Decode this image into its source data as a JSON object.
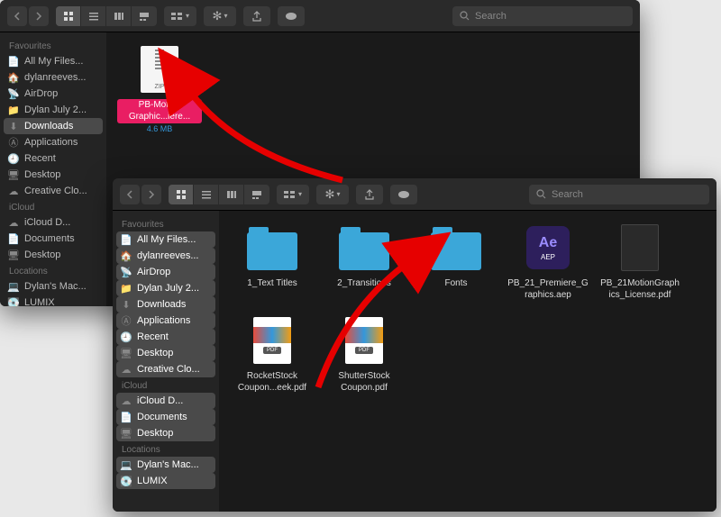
{
  "search_placeholder": "Search",
  "sidebar_common": {
    "favourites_header": "Favourites",
    "icloud_header": "iCloud",
    "locations_header": "Locations",
    "items_favourites": [
      {
        "icon": "doc",
        "label": "All My Files..."
      },
      {
        "icon": "house",
        "label": "dylanreeves..."
      },
      {
        "icon": "airdrop",
        "label": "AirDrop"
      },
      {
        "icon": "folder",
        "label": "Dylan July 2..."
      },
      {
        "icon": "download",
        "label": "Downloads"
      },
      {
        "icon": "app",
        "label": "Applications"
      },
      {
        "icon": "clock",
        "label": "Recent"
      },
      {
        "icon": "desktop",
        "label": "Desktop"
      },
      {
        "icon": "cloud",
        "label": "Creative Clo..."
      }
    ],
    "items_icloud": [
      {
        "icon": "cloud",
        "label": "iCloud D..."
      },
      {
        "icon": "doc",
        "label": "Documents"
      },
      {
        "icon": "desktop",
        "label": "Desktop"
      }
    ],
    "items_locations": [
      {
        "icon": "laptop",
        "label": "Dylan's Mac..."
      },
      {
        "icon": "disk",
        "label": "LUMIX"
      }
    ]
  },
  "window1": {
    "selected_sidebar": "Downloads",
    "file": {
      "name": "PB-Motion Graphic...iere...",
      "meta": "4.6 MB",
      "zip_label": "ZIP"
    }
  },
  "window2": {
    "files": [
      {
        "kind": "folder",
        "label": "1_Text Titles"
      },
      {
        "kind": "folder",
        "label": "2_Transitions"
      },
      {
        "kind": "folder",
        "label": "Fonts"
      },
      {
        "kind": "aep",
        "label": "PB_21_Premiere_Graphics.aep",
        "ae": "Ae",
        "ext": "AEP"
      },
      {
        "kind": "pdf",
        "label": "PB_21MotionGraphics_License.pdf"
      },
      {
        "kind": "thumb",
        "label": "RocketStock Coupon...eek.pdf",
        "tag": "PDF"
      },
      {
        "kind": "thumb",
        "label": "ShutterStock Coupon.pdf",
        "tag": "PDF"
      }
    ]
  }
}
